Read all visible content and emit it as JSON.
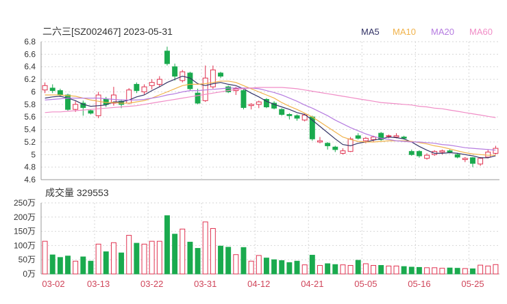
{
  "header": {
    "title": "二六三[SZ002467] 2023-05-31",
    "legend": [
      {
        "name": "MA5",
        "color": "#333366"
      },
      {
        "name": "MA10",
        "color": "#f0b24a"
      },
      {
        "name": "MA20",
        "color": "#b57be0"
      },
      {
        "name": "MA60",
        "color": "#f08cc6"
      }
    ]
  },
  "volume_panel": {
    "title": "成交量 329553"
  },
  "colors": {
    "up": "#e0304e",
    "down": "#1aaa4e",
    "grid": "#d6d6d6",
    "axis": "#555555",
    "date_label": "#d0455a"
  },
  "chart_data": [
    {
      "type": "candlestick",
      "title": "二六三[SZ002467] 2023-05-31",
      "y_ticks": [
        "6.8",
        "6.6",
        "6.4",
        "6.2",
        "6",
        "5.8",
        "5.6",
        "5.4",
        "5.2",
        "5",
        "4.8",
        "4.6"
      ],
      "ylim": [
        4.6,
        6.8
      ],
      "x_tick_labels": [
        {
          "label": "03-02",
          "index": 0
        },
        {
          "label": "03-13",
          "index": 7
        },
        {
          "label": "03-22",
          "index": 14
        },
        {
          "label": "03-31",
          "index": 21
        },
        {
          "label": "04-12",
          "index": 28
        },
        {
          "label": "04-21",
          "index": 35
        },
        {
          "label": "05-05",
          "index": 42
        },
        {
          "label": "05-16",
          "index": 49
        },
        {
          "label": "05-25",
          "index": 56
        }
      ],
      "ohlc": [
        [
          6.03,
          6.15,
          5.98,
          6.1
        ],
        [
          6.06,
          6.12,
          5.98,
          6.02
        ],
        [
          6.02,
          6.05,
          5.92,
          5.95
        ],
        [
          5.95,
          5.97,
          5.7,
          5.72
        ],
        [
          5.72,
          5.85,
          5.68,
          5.8
        ],
        [
          5.82,
          5.86,
          5.62,
          5.75
        ],
        [
          5.7,
          5.72,
          5.64,
          5.66
        ],
        [
          5.62,
          6.0,
          5.58,
          5.95
        ],
        [
          5.88,
          5.92,
          5.76,
          5.8
        ],
        [
          5.82,
          6.08,
          5.78,
          5.95
        ],
        [
          5.85,
          5.88,
          5.74,
          5.8
        ],
        [
          5.82,
          6.06,
          5.8,
          6.03
        ],
        [
          6.12,
          6.15,
          5.98,
          6.02
        ],
        [
          6.0,
          6.12,
          5.96,
          6.08
        ],
        [
          6.1,
          6.2,
          6.04,
          6.15
        ],
        [
          6.12,
          6.25,
          6.08,
          6.2
        ],
        [
          6.65,
          6.72,
          6.42,
          6.45
        ],
        [
          6.4,
          6.45,
          6.18,
          6.25
        ],
        [
          6.18,
          6.35,
          6.15,
          6.32
        ],
        [
          6.3,
          6.32,
          6.02,
          6.05
        ],
        [
          5.98,
          6.05,
          5.8,
          5.82
        ],
        [
          5.86,
          6.42,
          5.84,
          6.22
        ],
        [
          6.08,
          6.42,
          6.05,
          6.35
        ],
        [
          6.3,
          6.32,
          6.22,
          6.25
        ],
        [
          6.08,
          6.1,
          5.98,
          6.0
        ],
        [
          6.02,
          6.08,
          5.95,
          6.05
        ],
        [
          6.02,
          6.05,
          5.72,
          5.75
        ],
        [
          5.78,
          5.82,
          5.72,
          5.8
        ],
        [
          5.8,
          5.86,
          5.74,
          5.84
        ],
        [
          5.88,
          5.9,
          5.74,
          5.76
        ],
        [
          5.82,
          5.85,
          5.72,
          5.74
        ],
        [
          5.72,
          5.74,
          5.62,
          5.64
        ],
        [
          5.64,
          5.66,
          5.56,
          5.62
        ],
        [
          5.62,
          5.64,
          5.54,
          5.58
        ],
        [
          5.55,
          5.65,
          5.53,
          5.63
        ],
        [
          5.6,
          5.62,
          5.22,
          5.25
        ],
        [
          5.2,
          5.28,
          5.18,
          5.22
        ],
        [
          5.18,
          5.2,
          5.08,
          5.14
        ],
        [
          5.12,
          5.14,
          5.04,
          5.08
        ],
        [
          5.02,
          5.1,
          5.0,
          5.06
        ],
        [
          5.05,
          5.28,
          5.04,
          5.25
        ],
        [
          5.3,
          5.34,
          5.24,
          5.26
        ],
        [
          5.22,
          5.28,
          5.18,
          5.26
        ],
        [
          5.24,
          5.3,
          5.2,
          5.28
        ],
        [
          5.34,
          5.36,
          5.22,
          5.24
        ],
        [
          5.3,
          5.32,
          5.26,
          5.3
        ],
        [
          5.28,
          5.34,
          5.26,
          5.3
        ],
        [
          5.28,
          5.3,
          5.24,
          5.26
        ],
        [
          5.05,
          5.08,
          4.98,
          5.0
        ],
        [
          5.05,
          5.07,
          4.95,
          4.98
        ],
        [
          4.94,
          5.02,
          4.92,
          4.99
        ],
        [
          5.0,
          5.07,
          4.98,
          5.05
        ],
        [
          5.04,
          5.08,
          5.0,
          5.06
        ],
        [
          5.06,
          5.08,
          5.02,
          5.04
        ],
        [
          5.0,
          5.02,
          4.94,
          4.96
        ],
        [
          4.92,
          4.96,
          4.88,
          4.94
        ],
        [
          4.95,
          4.96,
          4.8,
          4.86
        ],
        [
          4.85,
          4.96,
          4.82,
          4.94
        ],
        [
          4.96,
          5.08,
          4.94,
          5.04
        ],
        [
          5.02,
          5.14,
          5.0,
          5.1
        ]
      ],
      "series": [
        {
          "name": "MA5",
          "values": [
            5.9,
            5.92,
            5.93,
            5.9,
            5.86,
            5.8,
            5.77,
            5.78,
            5.79,
            5.84,
            5.84,
            5.87,
            5.92,
            5.95,
            6.02,
            6.08,
            6.15,
            6.2,
            6.25,
            6.22,
            6.13,
            6.1,
            6.13,
            6.15,
            6.12,
            6.1,
            6.05,
            5.98,
            5.92,
            5.85,
            5.8,
            5.76,
            5.72,
            5.67,
            5.64,
            5.55,
            5.45,
            5.35,
            5.25,
            5.16,
            5.14,
            5.18,
            5.2,
            5.23,
            5.25,
            5.28,
            5.27,
            5.25,
            5.2,
            5.13,
            5.07,
            5.02,
            5.02,
            5.03,
            5.02,
            5,
            4.98,
            4.95,
            4.95,
            4.98
          ]
        },
        {
          "name": "MA10",
          "values": [
            5.95,
            5.95,
            5.95,
            5.94,
            5.93,
            5.9,
            5.87,
            5.85,
            5.83,
            5.83,
            5.82,
            5.82,
            5.84,
            5.86,
            5.9,
            5.95,
            6,
            6.05,
            6.1,
            6.12,
            6.12,
            6.13,
            6.15,
            6.17,
            6.17,
            6.15,
            6.1,
            6.05,
            6,
            5.95,
            5.9,
            5.83,
            5.77,
            5.72,
            5.66,
            5.6,
            5.52,
            5.44,
            5.36,
            5.28,
            5.24,
            5.21,
            5.2,
            5.2,
            5.21,
            5.22,
            5.22,
            5.22,
            5.21,
            5.19,
            5.17,
            5.14,
            5.12,
            5.09,
            5.06,
            5.03,
            5.01,
            5,
            4.99,
            4.99
          ]
        },
        {
          "name": "MA20",
          "values": [
            5.87,
            5.88,
            5.89,
            5.9,
            5.9,
            5.9,
            5.9,
            5.9,
            5.89,
            5.88,
            5.87,
            5.87,
            5.87,
            5.88,
            5.9,
            5.92,
            5.95,
            5.97,
            6,
            6.02,
            6.02,
            6.03,
            6.04,
            6.05,
            6.06,
            6.06,
            6.06,
            6.06,
            6.05,
            6.02,
            5.99,
            5.95,
            5.9,
            5.85,
            5.79,
            5.74,
            5.68,
            5.62,
            5.55,
            5.49,
            5.43,
            5.38,
            5.33,
            5.29,
            5.26,
            5.24,
            5.22,
            5.21,
            5.2,
            5.2,
            5.19,
            5.18,
            5.16,
            5.15,
            5.13,
            5.11,
            5.1,
            5.09,
            5.08,
            5.07
          ]
        },
        {
          "name": "MA60",
          "values": [
            5.67,
            5.68,
            5.68,
            5.69,
            5.7,
            5.71,
            5.72,
            5.73,
            5.74,
            5.75,
            5.76,
            5.77,
            5.78,
            5.8,
            5.82,
            5.84,
            5.86,
            5.88,
            5.9,
            5.92,
            5.94,
            5.96,
            5.98,
            6,
            6.02,
            6.04,
            6.05,
            6.06,
            6.07,
            6.07,
            6.07,
            6.07,
            6.06,
            6.05,
            6.03,
            6.01,
            5.99,
            5.97,
            5.95,
            5.93,
            5.91,
            5.89,
            5.87,
            5.85,
            5.83,
            5.82,
            5.81,
            5.8,
            5.79,
            5.77,
            5.76,
            5.74,
            5.73,
            5.71,
            5.69,
            5.67,
            5.65,
            5.63,
            5.61,
            5.59
          ]
        }
      ]
    },
    {
      "type": "bar",
      "title": "成交量 329553",
      "y_ticks": [
        "250万",
        "200万",
        "150万",
        "100万",
        "50万",
        "0万"
      ],
      "ylim": [
        0,
        250
      ],
      "unit": "万",
      "values": [
        115,
        67,
        58,
        63,
        45,
        60,
        45,
        105,
        78,
        110,
        74,
        136,
        108,
        105,
        115,
        115,
        205,
        140,
        158,
        112,
        90,
        183,
        160,
        98,
        94,
        68,
        93,
        45,
        65,
        56,
        50,
        47,
        40,
        45,
        32,
        66,
        30,
        36,
        33,
        32,
        30,
        48,
        36,
        30,
        30,
        28,
        28,
        26,
        24,
        23,
        22,
        22,
        20,
        21,
        20,
        19,
        18,
        31,
        28,
        33
      ]
    }
  ]
}
